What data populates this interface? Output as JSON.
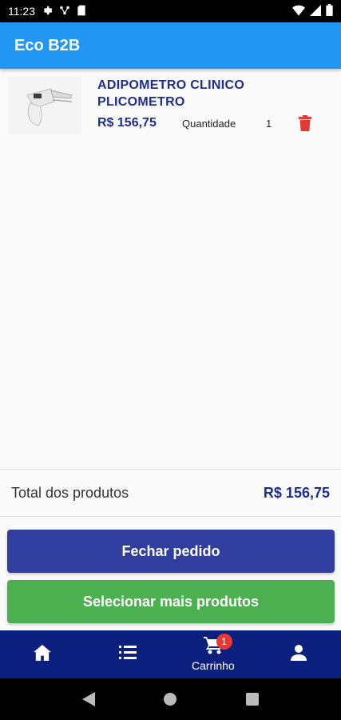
{
  "status_bar": {
    "time": "11:23"
  },
  "app_bar": {
    "title": "Eco B2B"
  },
  "cart": {
    "items": [
      {
        "name": "ADIPOMETRO CLINICO PLICOMETRO",
        "price": "R$ 156,75",
        "quantity_label": "Quantidade",
        "quantity": "1"
      }
    ]
  },
  "totals": {
    "label": "Total dos produtos",
    "value": "R$ 156,75"
  },
  "actions": {
    "close_order": "Fechar pedido",
    "select_more": "Selecionar mais produtos"
  },
  "bottom_nav": {
    "items": [
      {
        "icon": "home-icon",
        "label": ""
      },
      {
        "icon": "list-icon",
        "label": ""
      },
      {
        "icon": "cart-icon",
        "label": "Carrinho",
        "badge": "1"
      },
      {
        "icon": "person-icon",
        "label": ""
      }
    ]
  },
  "colors": {
    "app_bar": "#2196f3",
    "accent_text": "#1f2e8c",
    "primary_button": "#303f9f",
    "secondary_button": "#4caf50",
    "bottom_nav": "#0b1f7e",
    "delete": "#e53935"
  }
}
